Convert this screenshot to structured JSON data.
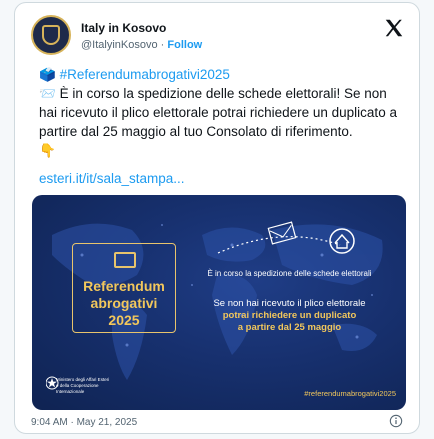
{
  "tweet": {
    "display_name": "Italy in Kosovo",
    "handle": "@ItalyinKosovo",
    "separator": "·",
    "follow_label": "Follow",
    "hashtag_emoji": "🗳️",
    "hashtag": "#Referendumabrogativi2025",
    "text_emoji": "📨",
    "text": "È in corso la spedizione delle schede elettorali! Se non hai ricevuto il plico elettorale potrai richiedere un duplicato a partire dal 25 maggio al tuo Consolato di riferimento.",
    "pointer_emoji": "👇",
    "link": "esteri.it/it/sala_stampa...",
    "timestamp": "9:04 AM · May 21, 2025"
  },
  "media": {
    "ref_line1": "Referendum",
    "ref_line2": "abrogativi",
    "ref_line3": "2025",
    "line1": "È in corso la spedizione delle schede elettorali",
    "line2": "Se non hai ricevuto il plico elettorale",
    "line3": "potrai richiedere un duplicato",
    "line4": "a partire dal 25 maggio",
    "ministry_line1": "Ministero degli Affari Esteri",
    "ministry_line2": "e della Cooperazione Internazionale",
    "hashtag": "#referendumabrogativi2025"
  },
  "icons": {
    "avatar": "italy-emblem-icon",
    "platform": "x-logo-icon",
    "info": "info-icon"
  },
  "colors": {
    "link": "#1d9bf0",
    "media_background": "#17306e",
    "gold": "#f2c75c"
  }
}
